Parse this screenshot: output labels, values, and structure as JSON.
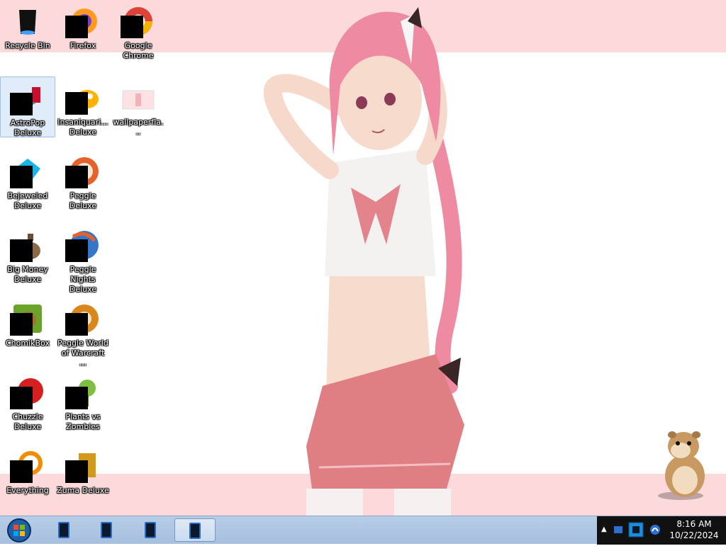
{
  "desktop": {
    "icons": [
      {
        "label": "Recycle Bin",
        "name": "recycle-bin"
      },
      {
        "label": "Firefox",
        "name": "firefox"
      },
      {
        "label": "Google Chrome",
        "name": "google-chrome"
      },
      {
        "label": "AstroPop Deluxe",
        "name": "astropop-deluxe"
      },
      {
        "label": "Insaniquari... Deluxe",
        "name": "insaniquarium-deluxe"
      },
      {
        "label": "wallpaperfla...",
        "name": "wallpaperflare"
      },
      {
        "label": "Bejeweled Deluxe",
        "name": "bejeweled-deluxe"
      },
      {
        "label": "Peggle Deluxe",
        "name": "peggle-deluxe"
      },
      {
        "label": "Big Money Deluxe",
        "name": "big-money-deluxe"
      },
      {
        "label": "Peggle Nights Deluxe",
        "name": "peggle-nights-deluxe"
      },
      {
        "label": "ChomikBox",
        "name": "chomikbox"
      },
      {
        "label": "Peggle World of Warcraft ...",
        "name": "peggle-world-of-warcraft"
      },
      {
        "label": "Chuzzle Deluxe",
        "name": "chuzzle-deluxe"
      },
      {
        "label": "Plants vs Zombies",
        "name": "plants-vs-zombies"
      },
      {
        "label": "Everything",
        "name": "everything"
      },
      {
        "label": "Zuma Deluxe",
        "name": "zuma-deluxe"
      }
    ]
  },
  "taskbar": {
    "clock_time": "8:16 AM",
    "clock_date": "10/22/2024"
  }
}
